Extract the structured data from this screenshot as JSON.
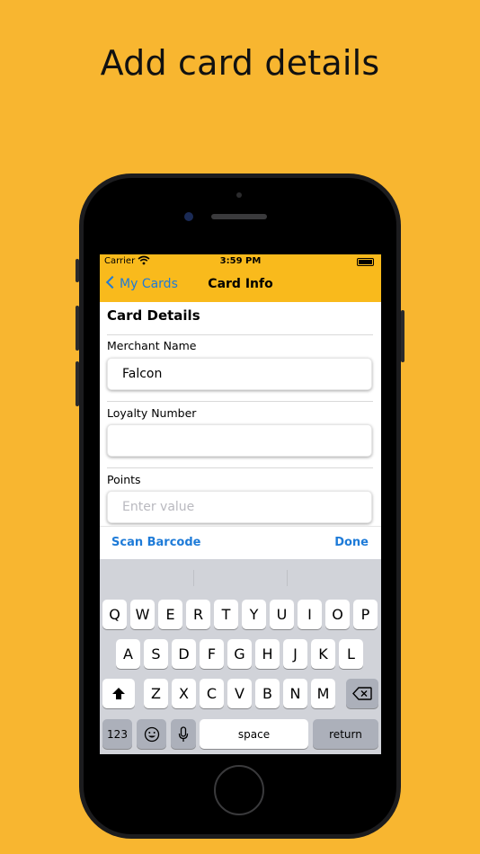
{
  "headline": "Add card details",
  "status_bar": {
    "carrier": "Carrier",
    "time": "3:59 PM"
  },
  "nav": {
    "back_label": "My Cards",
    "title": "Card Info"
  },
  "section_title": "Card Details",
  "fields": [
    {
      "label": "Merchant Name",
      "value": "Falcon",
      "placeholder": ""
    },
    {
      "label": "Loyalty Number",
      "value": "",
      "placeholder": ""
    },
    {
      "label": "Points",
      "value": "",
      "placeholder": "Enter value"
    }
  ],
  "accessory_bar": {
    "left": "Scan Barcode",
    "right": "Done"
  },
  "keyboard": {
    "row1": [
      "Q",
      "W",
      "E",
      "R",
      "T",
      "Y",
      "U",
      "I",
      "O",
      "P"
    ],
    "row2": [
      "A",
      "S",
      "D",
      "F",
      "G",
      "H",
      "J",
      "K",
      "L"
    ],
    "row3": [
      "Z",
      "X",
      "C",
      "V",
      "B",
      "N",
      "M"
    ],
    "numbers_key": "123",
    "space_key": "space",
    "return_key": "return"
  },
  "colors": {
    "background": "#F8B630",
    "navbar": "#F9BA1C",
    "accent": "#1E7BD8"
  },
  "icons": [
    "wifi-icon",
    "battery-icon",
    "chevron-left-icon",
    "shift-icon",
    "delete-icon",
    "emoji-icon",
    "microphone-icon"
  ]
}
